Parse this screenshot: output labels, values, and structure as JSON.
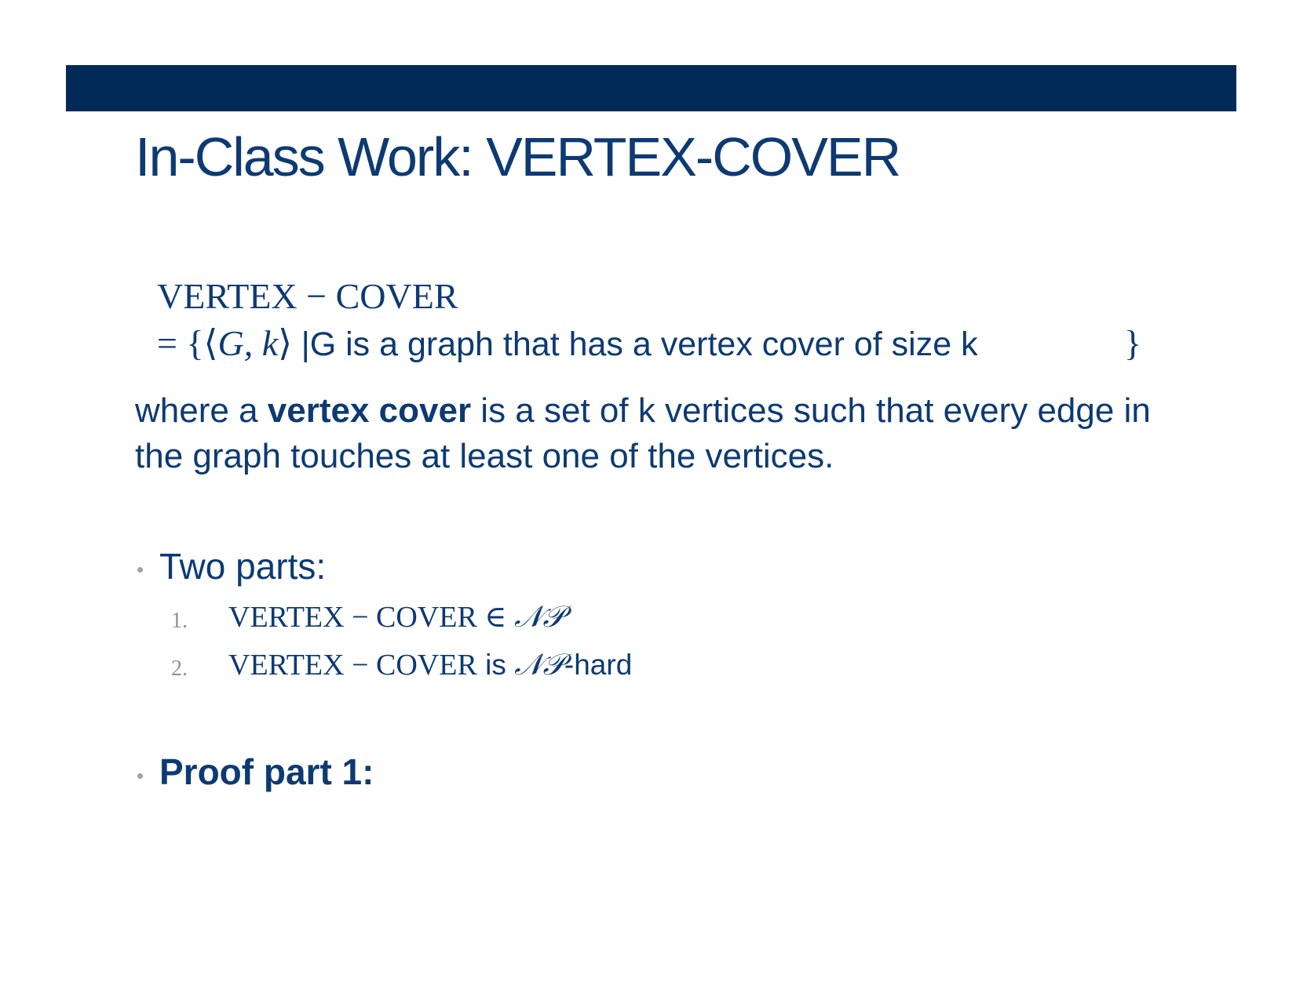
{
  "slide": {
    "title": "In-Class Work: VERTEX-COVER",
    "definition": {
      "lhs": "VERTEX − COVER",
      "rhs_math": "= {⟨",
      "rhs_vars": "G, k",
      "rhs_close": "⟩ ",
      "rhs_text": "|G is a graph that has a  vertex cover of size k",
      "rhs_brace": "}"
    },
    "where": {
      "prefix": "where a ",
      "term": "vertex cover",
      "suffix": " is a set of k vertices such that every edge in the graph touches at least one of the vertices."
    },
    "bullets": [
      {
        "text": "Two parts:"
      },
      {
        "text": "Proof part 1:"
      }
    ],
    "parts": [
      {
        "number": "1.",
        "math": "VERTEX − COVER ∈ ",
        "class": "𝒩𝒫",
        "suffix": ""
      },
      {
        "number": "2.",
        "math": "VERTEX − COVER",
        "text": " is ",
        "class": "𝒩𝒫",
        "suffix": "-hard"
      }
    ],
    "colors": {
      "bar": "#022a56",
      "text": "#0d3a73",
      "bullet": "#9aa5a7"
    }
  }
}
